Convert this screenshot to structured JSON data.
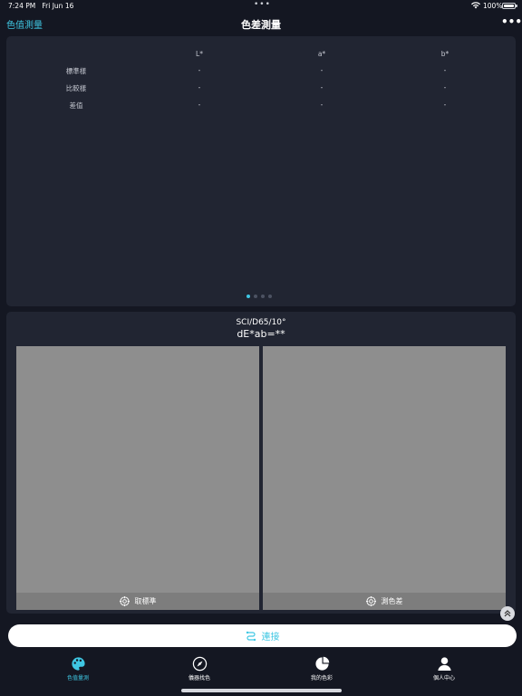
{
  "status_bar": {
    "time": "7:24 PM",
    "date": "Fri Jun 16",
    "center_dots": "•••",
    "battery": "100%"
  },
  "nav": {
    "back_label": "色值測量",
    "title": "色差測量",
    "more_label": "•••"
  },
  "lab_table": {
    "headers": [
      "L*",
      "a*",
      "b*"
    ],
    "rows": [
      {
        "label": "標準樣",
        "values": [
          "-",
          "-",
          "-"
        ]
      },
      {
        "label": "比較樣",
        "values": [
          "-",
          "-",
          "-"
        ]
      },
      {
        "label": "差值",
        "values": [
          "-",
          "-",
          "-"
        ]
      }
    ]
  },
  "pager": {
    "count": 4,
    "active": 0
  },
  "measurement": {
    "condition": "SCI/D65/10°",
    "delta_e": "dE*ab=**",
    "standard_button": "取標準",
    "sample_button": "測色差",
    "swatch_color": "#8e8e8e"
  },
  "connect": {
    "label": "連接"
  },
  "tabs": [
    {
      "label": "色值量測",
      "icon": "palette-icon",
      "active": true
    },
    {
      "label": "儀器找色",
      "icon": "compass-icon",
      "active": false
    },
    {
      "label": "我的色彩",
      "icon": "pie-chart-icon",
      "active": false
    },
    {
      "label": "個人中心",
      "icon": "person-icon",
      "active": false
    }
  ],
  "colors": {
    "accent": "#3fc7e3",
    "background": "#141722",
    "card": "#212532"
  }
}
